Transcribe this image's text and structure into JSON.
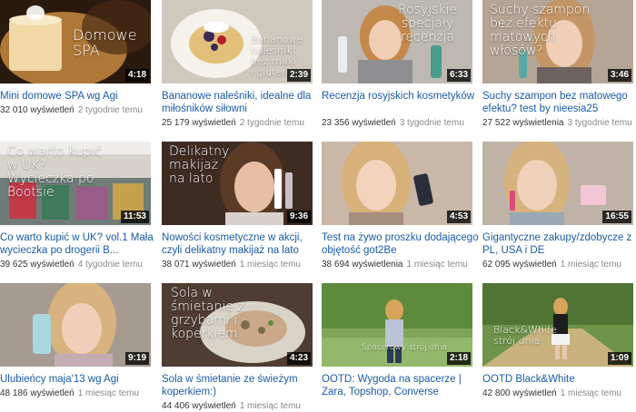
{
  "videos": [
    {
      "title": "Mini domowe SPA wg Agi",
      "views": "32 010 wyświetleń",
      "ago": "2 tygodnie temu",
      "duration": "4:18",
      "overlay": "Domowe\nSPA",
      "bg": "#d9a25a",
      "bg2": "#f3d8a8"
    },
    {
      "title": "Bananowe naleśniki, idealne dla miłośników siłowni",
      "views": "25 179 wyświetleń",
      "ago": "2 tygodnie temu",
      "duration": "2:39",
      "overlay": "Bananowe\nnaleśniki\nbez maki\ni glutenu",
      "bg": "#c9c3b8",
      "bg2": "#efeae3"
    },
    {
      "title": "Recenzja rosyjskich kosmetyków",
      "views": "23 356 wyświetleń",
      "ago": "3 tygodnie temu",
      "duration": "6:33",
      "overlay": "Rosyjskie\nspecjały\nrecenzja",
      "bg": "#b8b6b0",
      "bg2": "#e7e3dc"
    },
    {
      "title": "Suchy szampon bez matowego efektu? test by nieesia25",
      "views": "27 522 wyświetlenia",
      "ago": "3 tygodnie temu",
      "duration": "3:46",
      "overlay": "Suchy szampon\nbez efektu\nmatowych\nwłosów?",
      "bg": "#b7a89a",
      "bg2": "#ddd2c6"
    },
    {
      "title": "Co warto kupić w UK? vol.1 Mała wycieczka po drogerii B...",
      "views": "39 625 wyświetleń",
      "ago": "4 tygodnie temu",
      "duration": "11:53",
      "overlay": "Co warto kupić\nw UK?\nWycieczka po\nBootsie",
      "bg": "#6c7f7a",
      "bg2": "#c8c5bd"
    },
    {
      "title": "Nowości kosmetyczne w akcji, czyli delikatny makijaż na lato",
      "views": "38 071 wyświetleń",
      "ago": "1 miesiąc temu",
      "duration": "9:36",
      "overlay": "Delikatny\nmakijaż\nna lato",
      "bg": "#5a3f33",
      "bg2": "#c89b82"
    },
    {
      "title": "Test na żywo proszku dodającego objętość got2Be",
      "views": "38 694 wyświetlenia",
      "ago": "1 miesiąc temu",
      "duration": "4:53",
      "overlay": "",
      "bg": "#c7b4a4",
      "bg2": "#efe6dc"
    },
    {
      "title": "Gigantyczne zakupy/zdobycze z PL, USA i DE",
      "views": "62 095 wyświetleń",
      "ago": "1 miesiąc temu",
      "duration": "16:55",
      "overlay": "",
      "bg": "#b7aba1",
      "bg2": "#e4ddd5"
    },
    {
      "title": "Ulubieńcy maja'13 wg Agi",
      "views": "48 186 wyświetleń",
      "ago": "1 miesiąc temu",
      "duration": "9:19",
      "overlay": "",
      "bg": "#a99e94",
      "bg2": "#d8d0c8"
    },
    {
      "title": "Sola w śmietanie ze świeżym koperkiem:)",
      "views": "44 406 wyświetleń",
      "ago": "1 miesiąc temu",
      "duration": "4:23",
      "overlay": "Sola w\nśmietanie z\ngrzybami i\nkoperkiem",
      "bg": "#5d4a3f",
      "bg2": "#b89a84"
    },
    {
      "title": "OOTD: Wygoda na spacerze | Zara, Topshop, Converse",
      "views": "",
      "ago": "",
      "duration": "2:18",
      "overlay": "Spacerowy strój dnia",
      "bg": "#5f8a3d",
      "bg2": "#b7cf8e"
    },
    {
      "title": "OOTD Black&White",
      "views": "42 800 wyświetleń",
      "ago": "1 miesiąc temu",
      "duration": "1:09",
      "overlay": "Black&White\nstrój dnia",
      "bg": "#4e6f34",
      "bg2": "#9db873"
    }
  ]
}
